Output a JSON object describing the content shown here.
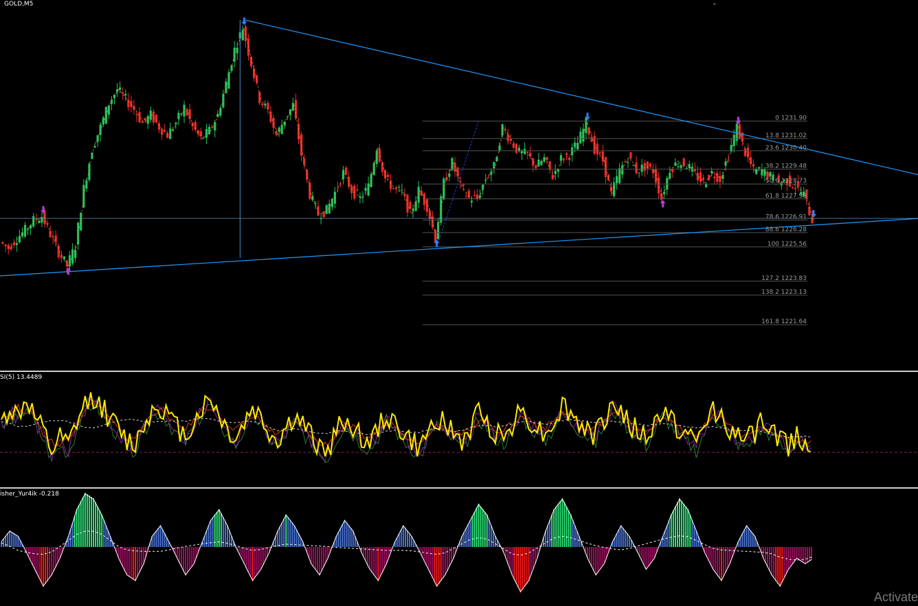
{
  "window": {
    "symbol_title": "GOLD,M5",
    "rsi_title": "SI(5) 13.4489",
    "fisher_title": "isher_Yur4ik -0.218",
    "watermark": "Activate",
    "colors": {
      "background": "#000000",
      "bull_candle": "#22c55e",
      "bear_candle": "#ef2b2b",
      "trendline": "#1e9bff",
      "fib_line": "#555555",
      "fib_text": "#9a9a9a",
      "arrow_down": "#2a7fff",
      "arrow_up_purple": "#b040d0",
      "rsi_main": "#ffea00",
      "rsi_red": "#e23a1a",
      "rsi_green": "#2e7d32",
      "rsi_purple": "#8e24aa",
      "fisher_pos": "#4a74d6",
      "fisher_pos_strong": "#2ee87a",
      "fisher_neg": "#a01060",
      "fisher_neg_strong": "#ff1a1a"
    }
  },
  "chart_data": [
    {
      "type": "candlestick",
      "title": "GOLD,M5",
      "price_axis": "right (hidden)",
      "fibonacci_levels": [
        {
          "label": "0 1231.90",
          "price": 1231.9
        },
        {
          "label": "13.8 1231.02",
          "price": 1231.02
        },
        {
          "label": "23.6 1230.40",
          "price": 1230.4
        },
        {
          "label": "38.2 1229.48",
          "price": 1229.48
        },
        {
          "label": "50.0 1228.73",
          "price": 1228.73
        },
        {
          "label": "61.8 1227.98",
          "price": 1227.98
        },
        {
          "label": "78.6 1226.91",
          "price": 1226.91
        },
        {
          "label": "88.6 1226.28",
          "price": 1226.28
        },
        {
          "label": "100 1225.56",
          "price": 1225.56
        },
        {
          "label": "127.2 1223.83",
          "price": 1223.83
        },
        {
          "label": "138.2 1223.13",
          "price": 1223.13
        },
        {
          "label": "161.8 1221.64",
          "price": 1221.64
        }
      ],
      "fib_visible_labels": [
        "0 1231.90",
        "13.8 1231.02",
        "23.6 1230.40",
        "1229.48",
        "50.0",
        "73",
        "61.8 1227.9",
        "78.6 1226.91",
        "88.6 1226.28",
        "100 1225.56",
        "127.2 1223.83",
        "138.2 1223.13",
        "161.8 1221.64"
      ],
      "close_path": [
        1225.8,
        1225.5,
        1226.0,
        1226.4,
        1226.9,
        1227.1,
        1226.2,
        1225.3,
        1224.6,
        1225.6,
        1228.5,
        1230.5,
        1231.6,
        1232.8,
        1233.5,
        1233.0,
        1232.5,
        1231.8,
        1232.2,
        1231.6,
        1231.2,
        1231.8,
        1232.6,
        1231.6,
        1231.0,
        1231.4,
        1232.2,
        1233.8,
        1235.5,
        1236.6,
        1234.8,
        1233.0,
        1232.4,
        1231.2,
        1232.0,
        1232.7,
        1230.2,
        1228.2,
        1227.2,
        1227.4,
        1228.3,
        1229.3,
        1228.4,
        1228.0,
        1228.6,
        1230.6,
        1229.0,
        1228.5,
        1228.3,
        1227.2,
        1228.4,
        1227.6,
        1226.0,
        1228.8,
        1229.8,
        1228.6,
        1228.0,
        1228.0,
        1229.0,
        1229.6,
        1231.6,
        1230.9,
        1230.3,
        1230.2,
        1229.6,
        1230.0,
        1229.1,
        1230.0,
        1230.2,
        1230.8,
        1231.8,
        1230.5,
        1229.9,
        1228.2,
        1229.4,
        1230.1,
        1229.4,
        1229.6,
        1229.4,
        1228.0,
        1229.5,
        1229.8,
        1229.7,
        1229.2,
        1228.8,
        1229.3,
        1229.0,
        1230.2,
        1231.6,
        1230.3,
        1229.4,
        1229.4,
        1229.1,
        1228.8,
        1228.9,
        1228.6,
        1228.2,
        1226.9
      ],
      "upper_trendline": "from spike high (~1237) sloping down to right edge",
      "lower_trendline": "from swing low (~1224.6) sloping up to right edge",
      "horizontal_line_price": 1227.0,
      "arrows": [
        {
          "type": "down",
          "color": "purple",
          "at_index": 5
        },
        {
          "type": "up",
          "color": "purple",
          "at_index": 8
        },
        {
          "type": "down",
          "color": "blue",
          "at_index": 29
        },
        {
          "type": "up",
          "color": "blue",
          "at_index": 52
        },
        {
          "type": "down",
          "color": "blue",
          "at_index": 70
        },
        {
          "type": "up",
          "color": "purple",
          "at_index": 79
        },
        {
          "type": "down",
          "color": "purple",
          "at_index": 88
        },
        {
          "type": "down",
          "color": "blue",
          "at_index": 97
        }
      ]
    },
    {
      "type": "line",
      "title": "SI(5) 13.4489",
      "ylim": [
        0,
        100
      ],
      "level": 30,
      "series": [
        {
          "values": [
            55,
            70,
            62,
            78,
            60,
            48,
            30,
            42,
            35,
            56,
            72,
            80,
            70,
            60,
            50,
            40,
            38,
            55,
            68,
            72,
            62,
            52,
            45,
            58,
            70,
            78,
            64,
            50,
            42,
            56,
            70,
            60,
            48,
            40,
            52,
            62,
            54,
            44,
            36,
            30,
            48,
            60,
            52,
            44,
            38,
            50,
            64,
            56,
            46,
            40,
            32,
            48,
            62,
            54,
            46,
            40,
            50,
            66,
            58,
            48,
            44,
            56,
            68,
            60,
            52,
            46,
            58,
            72,
            64,
            56,
            50,
            44,
            60,
            74,
            66,
            56,
            48,
            42,
            54,
            68,
            60,
            50,
            44,
            38,
            54,
            70,
            62,
            52,
            44,
            40,
            48,
            58,
            50,
            42,
            36,
            46,
            40,
            34
          ]
        }
      ]
    },
    {
      "type": "histogram",
      "title": "isher_Yur4ik -0.218",
      "ylim": [
        -1,
        1
      ],
      "series": [
        {
          "values": [
            0.1,
            0.3,
            0.2,
            -0.1,
            -0.4,
            -0.7,
            -0.5,
            -0.2,
            0.2,
            0.7,
            1.0,
            0.9,
            0.6,
            0.2,
            -0.2,
            -0.5,
            -0.6,
            -0.3,
            0.2,
            0.4,
            0.1,
            -0.2,
            -0.5,
            -0.3,
            0.1,
            0.5,
            0.7,
            0.4,
            0.0,
            -0.3,
            -0.6,
            -0.4,
            -0.1,
            0.3,
            0.6,
            0.4,
            0.1,
            -0.3,
            -0.5,
            -0.2,
            0.2,
            0.5,
            0.3,
            -0.1,
            -0.4,
            -0.6,
            -0.3,
            0.1,
            0.4,
            0.2,
            -0.1,
            -0.4,
            -0.7,
            -0.5,
            -0.2,
            0.2,
            0.5,
            0.8,
            0.6,
            0.2,
            -0.1,
            -0.5,
            -0.8,
            -0.6,
            -0.2,
            0.3,
            0.7,
            0.9,
            0.6,
            0.2,
            -0.2,
            -0.5,
            -0.3,
            0.1,
            0.4,
            0.2,
            -0.1,
            -0.4,
            -0.2,
            0.2,
            0.6,
            0.9,
            0.7,
            0.3,
            -0.1,
            -0.4,
            -0.6,
            -0.3,
            0.1,
            0.4,
            0.2,
            -0.2,
            -0.5,
            -0.7,
            -0.4,
            -0.2,
            -0.3,
            -0.2
          ]
        }
      ]
    }
  ]
}
